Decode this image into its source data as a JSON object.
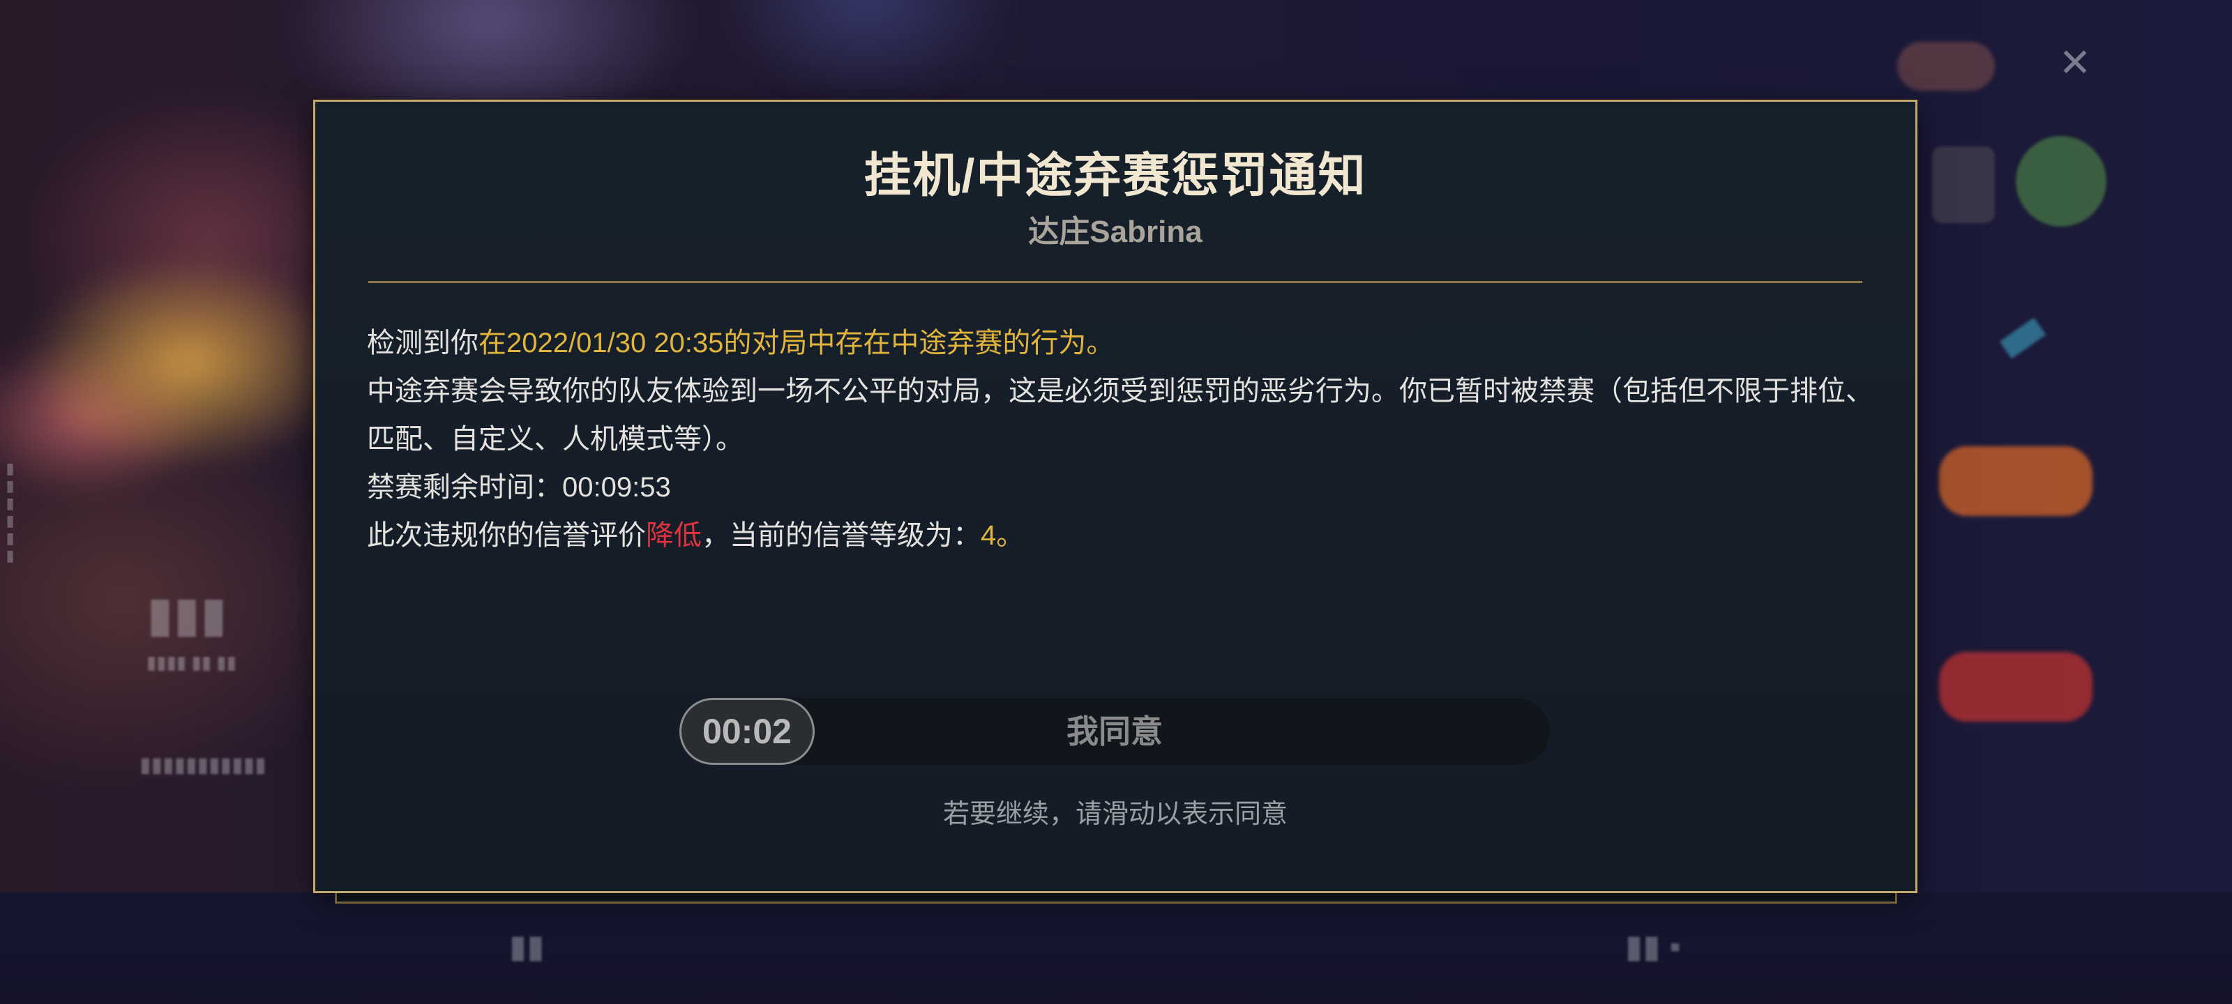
{
  "dialog": {
    "title": "挂机/中途弃赛惩罚通知",
    "player_name": "达庄Sabrina",
    "line1_prefix": "检测到你",
    "line1_highlight": "在2022/01/30 20:35的对局中存在中途弃赛的行为。",
    "line2": "中途弃赛会导致你的队友体验到一场不公平的对局，这是必须受到惩罚的恶劣行为。你已暂时被禁赛（包括但不限于排位、匹配、自定义、人机模式等）。",
    "ban_label": "禁赛剩余时间：",
    "ban_time": "00:09:53",
    "reputation_prefix": "此次违规你的信誉评价",
    "reputation_change": "降低",
    "reputation_mid": "，当前的信誉等级为：",
    "reputation_level": "4",
    "reputation_suffix": "。",
    "slider_timer": "00:02",
    "slider_label": "我同意",
    "hint": "若要继续，请滑动以表示同意"
  },
  "colors": {
    "accent_gold": "#c4a867",
    "highlight_yellow": "#e1b43c",
    "warning_red": "#e0323f"
  },
  "icons": {
    "close": "close-icon"
  },
  "close_glyph": "✕"
}
